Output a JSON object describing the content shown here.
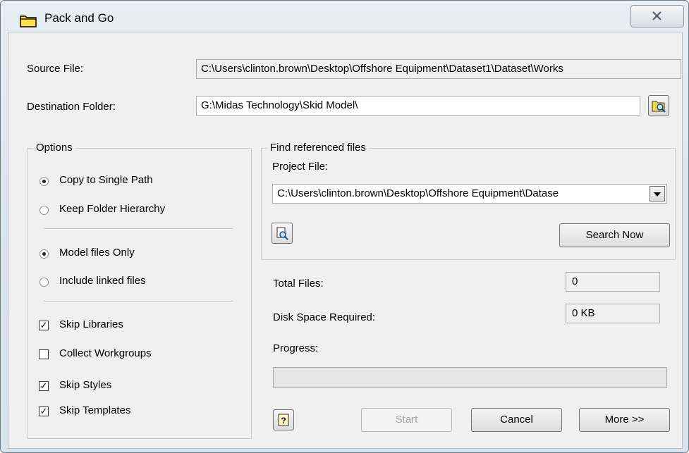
{
  "window": {
    "title": "Pack and Go"
  },
  "source": {
    "label": "Source File:",
    "value": "C:\\Users\\clinton.brown\\Desktop\\Offshore Equipment\\Dataset1\\Dataset\\Works"
  },
  "destination": {
    "label": "Destination Folder:",
    "value": "G:\\Midas Technology\\Skid Model\\"
  },
  "options": {
    "title": "Options",
    "copy_single": "Copy to Single Path",
    "keep_hierarchy": "Keep Folder Hierarchy",
    "model_only": "Model files Only",
    "include_linked": "Include linked files",
    "skip_libraries": "Skip Libraries",
    "collect_workgroups": "Collect Workgroups",
    "skip_styles": "Skip Styles",
    "skip_templates": "Skip Templates",
    "state": {
      "copy_single": true,
      "keep_hierarchy": false,
      "model_only": true,
      "include_linked": false,
      "skip_libraries": true,
      "collect_workgroups": false,
      "skip_styles": true,
      "skip_templates": true
    }
  },
  "find": {
    "title": "Find referenced files",
    "project_label": "Project File:",
    "project_value": "C:\\Users\\clinton.brown\\Desktop\\Offshore Equipment\\Datase",
    "search_now": "Search Now"
  },
  "stats": {
    "total_label": "Total Files:",
    "total_value": "0",
    "disk_label": "Disk Space Required:",
    "disk_value": "0 KB",
    "progress_label": "Progress:",
    "progress": 0
  },
  "buttons": {
    "start": "Start",
    "cancel": "Cancel",
    "more": "More >>"
  },
  "icons": {
    "title": "folder-icon",
    "browse": "browse-folder-icon",
    "search": "search-file-icon",
    "help": "help-icon",
    "close": "close-icon"
  }
}
